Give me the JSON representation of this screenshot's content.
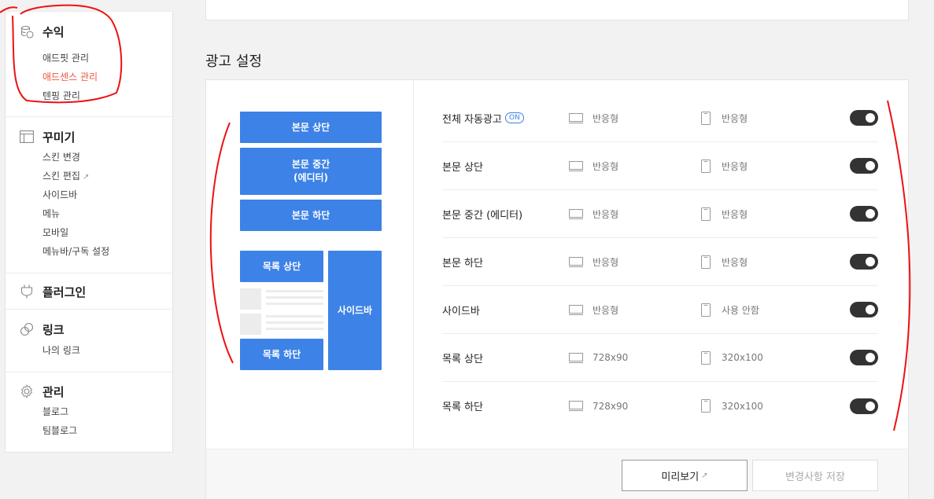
{
  "sidebar": {
    "revenue": {
      "title": "수익",
      "icon": "coins-icon",
      "items": [
        "애드핏 관리",
        "애드센스 관리",
        "텐핑 관리"
      ]
    },
    "design": {
      "title": "꾸미기",
      "icon": "layout-icon",
      "items": [
        "스킨 변경",
        "스킨 편집",
        "사이드바",
        "메뉴",
        "모바일",
        "메뉴바/구독 설정"
      ]
    },
    "plugin": {
      "title": "플러그인",
      "icon": "plug-icon"
    },
    "link": {
      "title": "링크",
      "icon": "link-icon",
      "items": [
        "나의 링크"
      ]
    },
    "manage": {
      "title": "관리",
      "icon": "gear-icon",
      "items": [
        "블로그",
        "팀블로그"
      ]
    },
    "active_color": "#f0533d"
  },
  "main": {
    "section_title": "광고 설정",
    "preview": {
      "body_top": "본문 상단",
      "body_mid_line1": "본문 중간",
      "body_mid_line2": "(에디터)",
      "body_bottom": "본문 하단",
      "list_top": "목록 상단",
      "list_bottom": "목록 하단",
      "sidebar": "사이드바",
      "slot_color": "#3d82e6"
    },
    "rows": [
      {
        "label": "전체 자동광고",
        "badge": "ON",
        "pc": "반응형",
        "mobile": "반응형",
        "enabled": true
      },
      {
        "label": "본문 상단",
        "pc": "반응형",
        "mobile": "반응형",
        "enabled": true
      },
      {
        "label": "본문 중간 (에디터)",
        "pc": "반응형",
        "mobile": "반응형",
        "enabled": true
      },
      {
        "label": "본문 하단",
        "pc": "반응형",
        "mobile": "반응형",
        "enabled": true
      },
      {
        "label": "사이드바",
        "pc": "반응형",
        "mobile": "사용 안함",
        "enabled": true
      },
      {
        "label": "목록 상단",
        "pc": "728x90",
        "mobile": "320x100",
        "enabled": true
      },
      {
        "label": "목록 하단",
        "pc": "728x90",
        "mobile": "320x100",
        "enabled": true
      }
    ],
    "buttons": {
      "preview": "미리보기",
      "save": "변경사항 저장"
    }
  }
}
